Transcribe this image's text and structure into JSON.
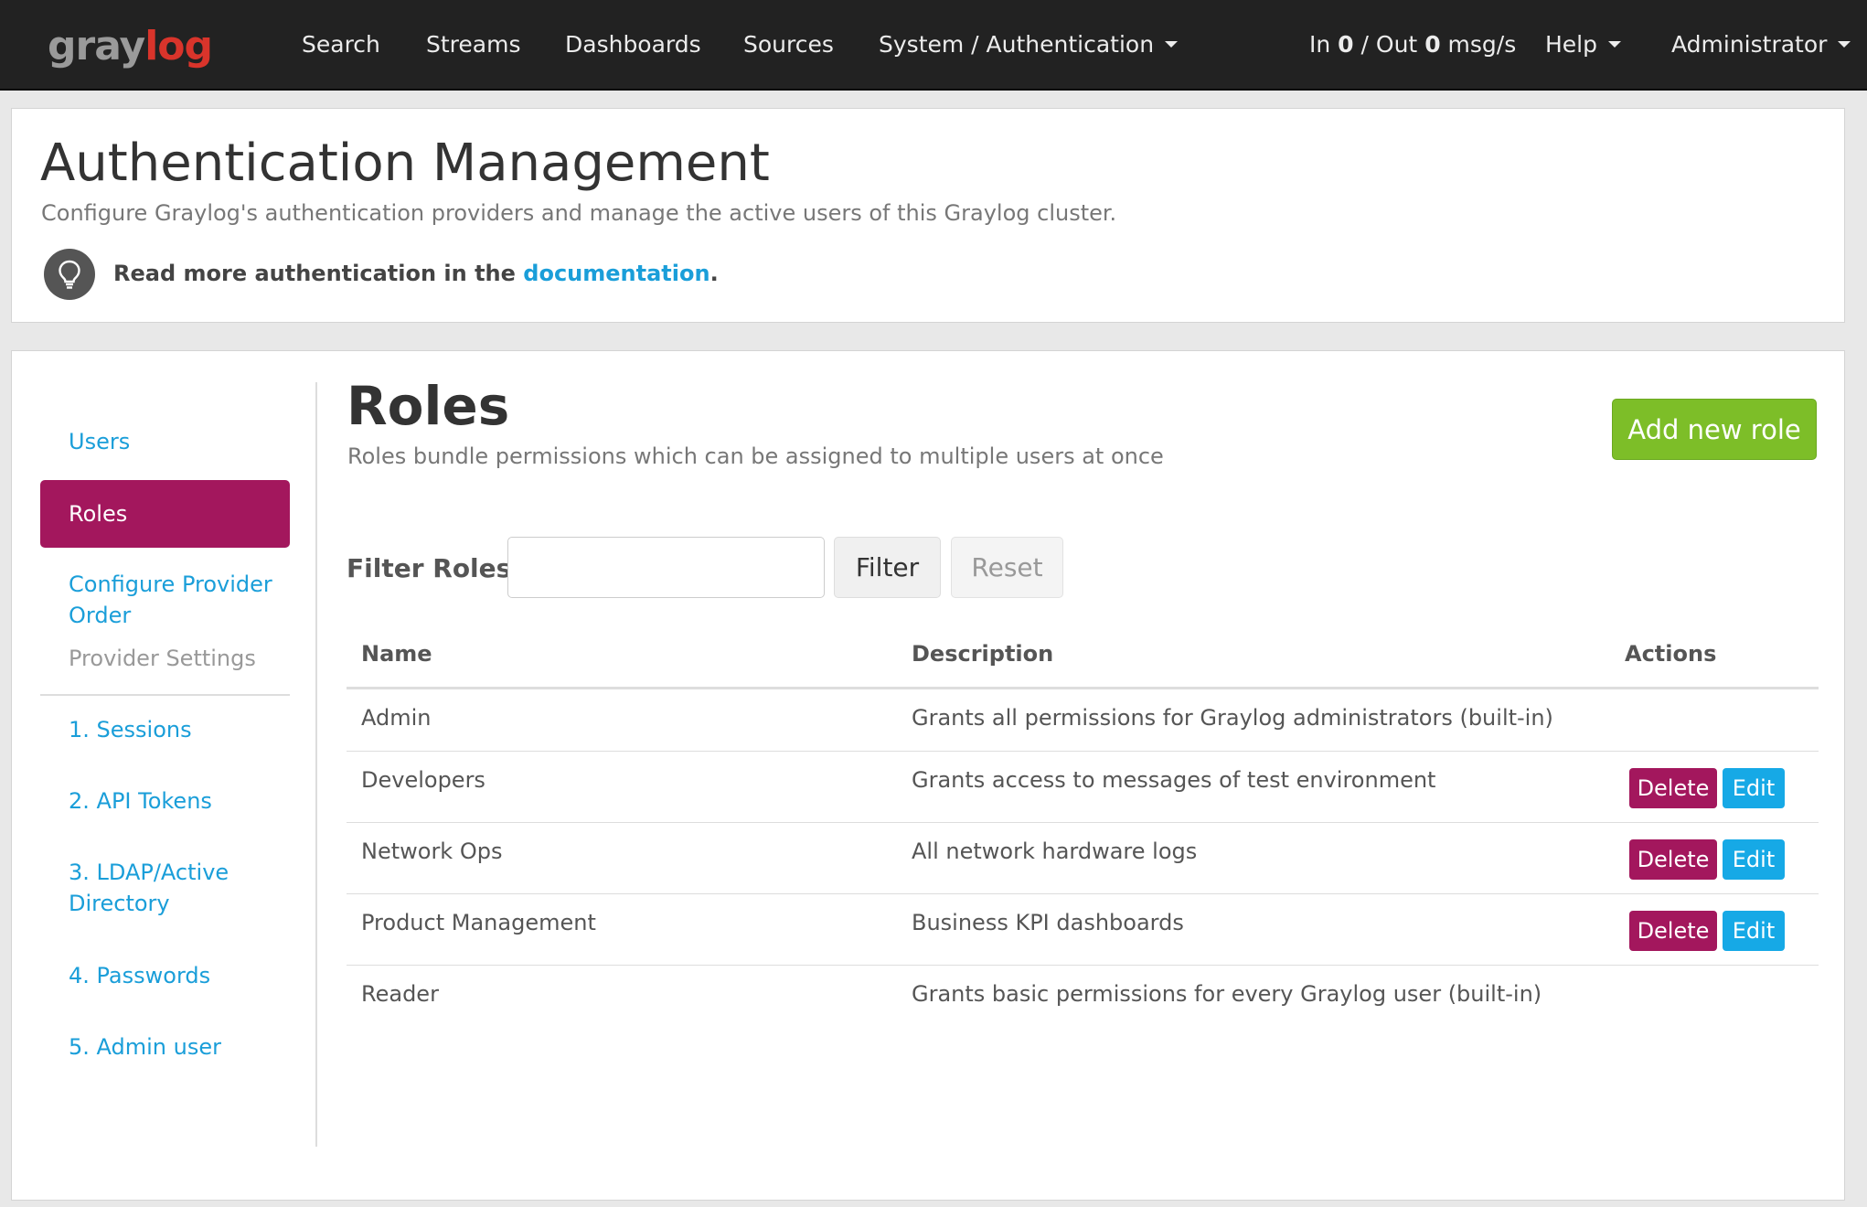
{
  "navbar": {
    "logo_gray": "gray",
    "logo_red": "log",
    "items": [
      "Search",
      "Streams",
      "Dashboards",
      "Sources"
    ],
    "system_menu": "System / Authentication",
    "throughput": {
      "in_label": "In",
      "in_value": "0",
      "sep": "/ Out",
      "out_value": "0",
      "unit": "msg/s"
    },
    "help": "Help",
    "user": "Administrator"
  },
  "header": {
    "title": "Authentication Management",
    "description": "Configure Graylog's authentication providers and manage the active users of this Graylog cluster.",
    "docs_prefix": "Read more authentication in the",
    "docs_link": "documentation",
    "docs_suffix": ".",
    "icon": "lightbulb-icon"
  },
  "sidebar": {
    "users": "Users",
    "roles": "Roles",
    "configure_order": [
      "Configure Provider",
      "Order"
    ],
    "provider_settings": "Provider Settings",
    "providers": [
      [
        "1. Sessions"
      ],
      [
        "2. API Tokens"
      ],
      [
        "3. LDAP/Active",
        "Directory"
      ],
      [
        "4. Passwords"
      ],
      [
        "5. Admin user"
      ]
    ]
  },
  "roles": {
    "title": "Roles",
    "description": "Roles bundle permissions which can be assigned to multiple users at once",
    "add_button": "Add new role",
    "filter_label": "Filter Roles",
    "filter_value": "",
    "filter_button": "Filter",
    "reset_button": "Reset",
    "columns": [
      "Name",
      "Description",
      "Actions"
    ],
    "rows": [
      {
        "name": "Admin",
        "description": "Grants all permissions for Graylog administrators (built-in)",
        "actions": []
      },
      {
        "name": "Developers",
        "description": "Grants access to messages of test environment",
        "actions": [
          "Delete",
          "Edit"
        ]
      },
      {
        "name": "Network Ops",
        "description": "All network hardware logs",
        "actions": [
          "Delete",
          "Edit"
        ]
      },
      {
        "name": "Product Management",
        "description": "Business KPI dashboards",
        "actions": [
          "Delete",
          "Edit"
        ]
      },
      {
        "name": "Reader",
        "description": "Grants basic permissions for every Graylog user (built-in)",
        "actions": []
      }
    ]
  },
  "colors": {
    "navbar": "#222222",
    "accent_magenta": "#a3175d",
    "link_blue": "#1a9ed9",
    "success_green": "#7dbe28",
    "edit_blue": "#16a9e6"
  }
}
